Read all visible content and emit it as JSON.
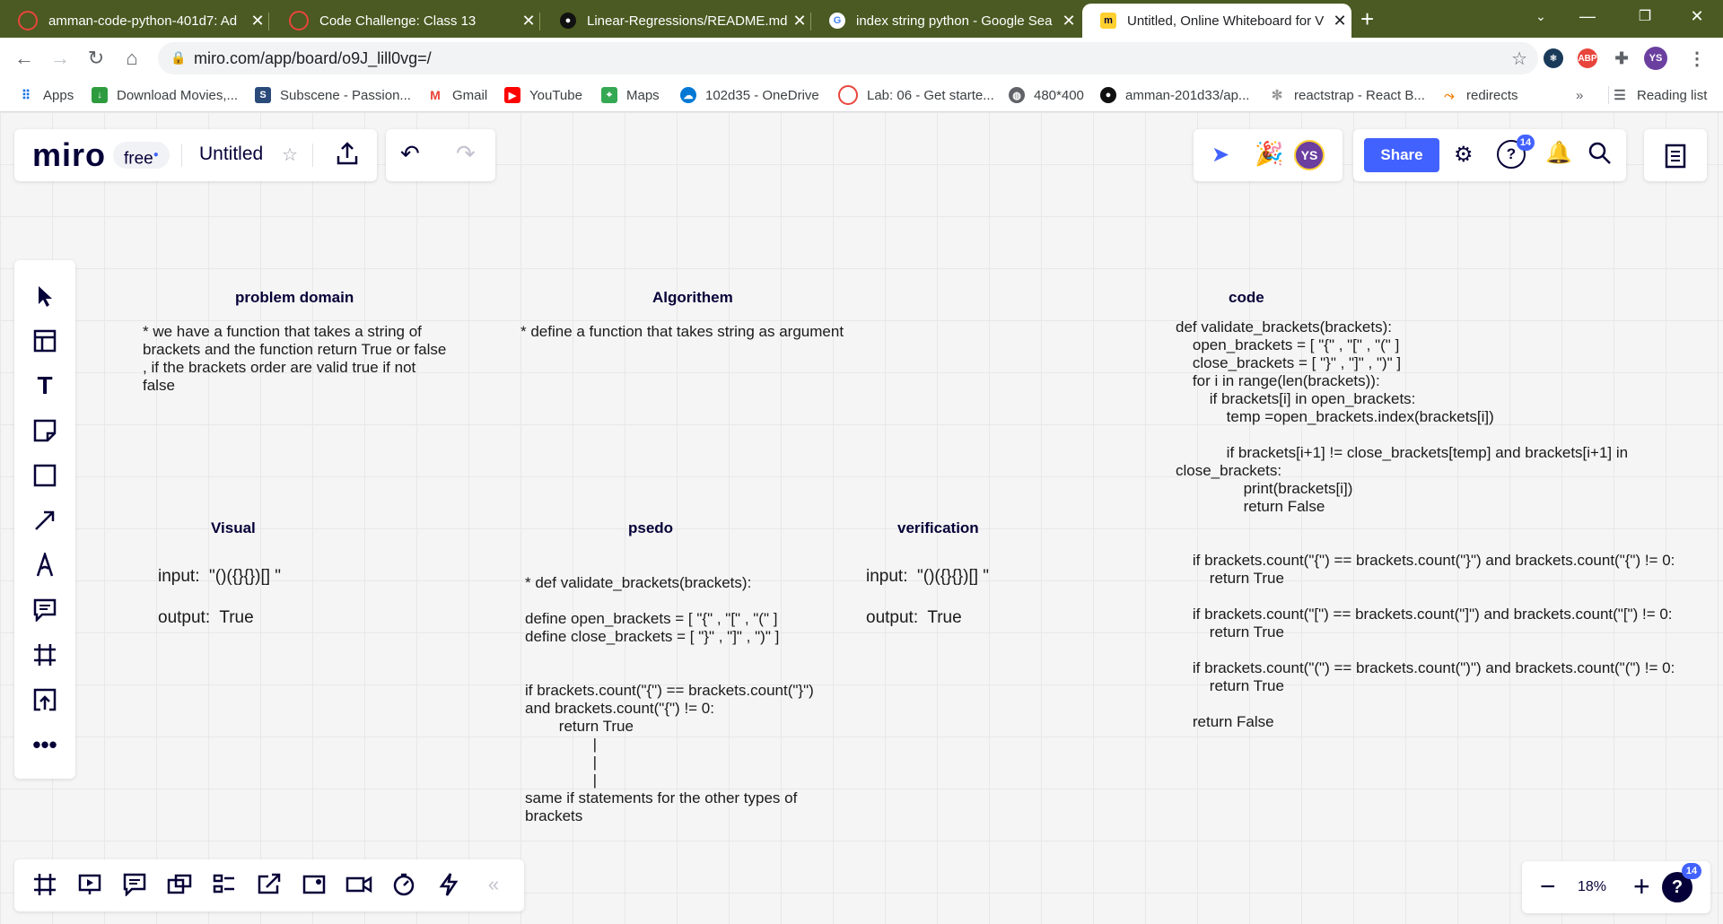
{
  "browser": {
    "tabs": [
      {
        "title": "amman-code-python-401d7: Ad",
        "favicon": "codefellows-icon",
        "color": "#e8453c"
      },
      {
        "title": "Code Challenge: Class 13",
        "favicon": "codefellows-icon",
        "color": "#e8453c"
      },
      {
        "title": "Linear-Regressions/README.md",
        "favicon": "github-icon",
        "color": "#111"
      },
      {
        "title": "index string python - Google Sea",
        "favicon": "google-icon",
        "color": "#4285f4"
      },
      {
        "title": "Untitled, Online Whiteboard for V",
        "favicon": "miro-icon",
        "color": "#ffd02f"
      }
    ],
    "new_tab": "+",
    "url": "miro.com/app/board/o9J_lill0vg=/",
    "profile_initials": "YS",
    "bookmarks": [
      {
        "label": "Apps",
        "icon": "apps-grid-icon"
      },
      {
        "label": "Download Movies,...",
        "icon": "download-icon"
      },
      {
        "label": "Subscene - Passion...",
        "icon": "subscene-icon"
      },
      {
        "label": "Gmail",
        "icon": "gmail-icon"
      },
      {
        "label": "YouTube",
        "icon": "youtube-icon"
      },
      {
        "label": "Maps",
        "icon": "maps-icon"
      },
      {
        "label": "102d35 - OneDrive",
        "icon": "onedrive-icon"
      },
      {
        "label": "Lab: 06 - Get starte...",
        "icon": "codefellows-icon"
      },
      {
        "label": "480*400",
        "icon": "globe-icon"
      },
      {
        "label": "amman-201d33/ap...",
        "icon": "github-icon"
      },
      {
        "label": "reactstrap - React B...",
        "icon": "reactstrap-icon"
      },
      {
        "label": "redirects",
        "icon": "redirects-icon"
      }
    ],
    "more_bookmarks": "»",
    "reading_list": "Reading list"
  },
  "miro": {
    "logo": "miro",
    "plan_badge": "free",
    "board_title": "Untitled",
    "share_label": "Share",
    "user_initials": "YS",
    "help_badge": "14",
    "zoom_level": "18%",
    "help_badge_bottom": "14",
    "collapse_label": "«"
  },
  "board": {
    "sections": {
      "problem_domain": {
        "heading": "problem domain",
        "text": "* we have a function that takes a string of\nbrackets and the function return True or false\n, if the brackets order are valid true if not\nfalse"
      },
      "algorithm": {
        "heading": "Algorithem",
        "text": "* define a function that takes string as argument"
      },
      "code": {
        "heading": "code",
        "text": "def validate_brackets(brackets):\n    open_brackets = [ \"{\" , \"[\" , \"(\" ]\n    close_brackets = [ \"}\" , \"]\" , \")\" ]\n    for i in range(len(brackets)):\n        if brackets[i] in open_brackets:\n            temp =open_brackets.index(brackets[i])\n\n            if brackets[i+1] != close_brackets[temp] and brackets[i+1] in\nclose_brackets:\n                print(brackets[i])\n                return False\n\n\n    if brackets.count(\"{\") == brackets.count(\"}\") and brackets.count(\"{\") != 0:\n        return True\n\n    if brackets.count(\"[\") == brackets.count(\"]\") and brackets.count(\"[\") != 0:\n        return True\n\n    if brackets.count(\"(\") == brackets.count(\")\") and brackets.count(\"(\") != 0:\n        return True\n\n    return False"
      },
      "visual": {
        "heading": "Visual",
        "input": "input:  \"()({}{})[] \"",
        "output": "output:  True"
      },
      "pseudo": {
        "heading": "psedo",
        "text": "* def validate_brackets(brackets):\n\ndefine open_brackets = [ \"{\" , \"[\" , \"(\" ]\ndefine close_brackets = [ \"}\" , \"]\" , \")\" ]\n\n\nif brackets.count(\"{\") == brackets.count(\"}\")\nand brackets.count(\"{\") != 0:\n        return True\n                |\n                |\n                |\nsame if statements for the other types of\nbrackets"
      },
      "verification": {
        "heading": "verification",
        "input": "input:  \"()({}{})[] \"",
        "output": "output:  True"
      }
    }
  },
  "icons": {
    "left_toolbar": [
      "cursor-icon",
      "templates-icon",
      "text-icon",
      "sticky-note-icon",
      "shape-icon",
      "connection-line-icon",
      "pen-icon",
      "comment-icon",
      "frame-icon",
      "upload-icon",
      "more-icon"
    ],
    "bottom_toolbar": [
      "frames-icon",
      "presentation-icon",
      "comments-list-icon",
      "video-chat-icon",
      "card-icon",
      "screen-share-icon",
      "board-icon",
      "video-icon",
      "timer-icon",
      "lightning-icon"
    ]
  }
}
